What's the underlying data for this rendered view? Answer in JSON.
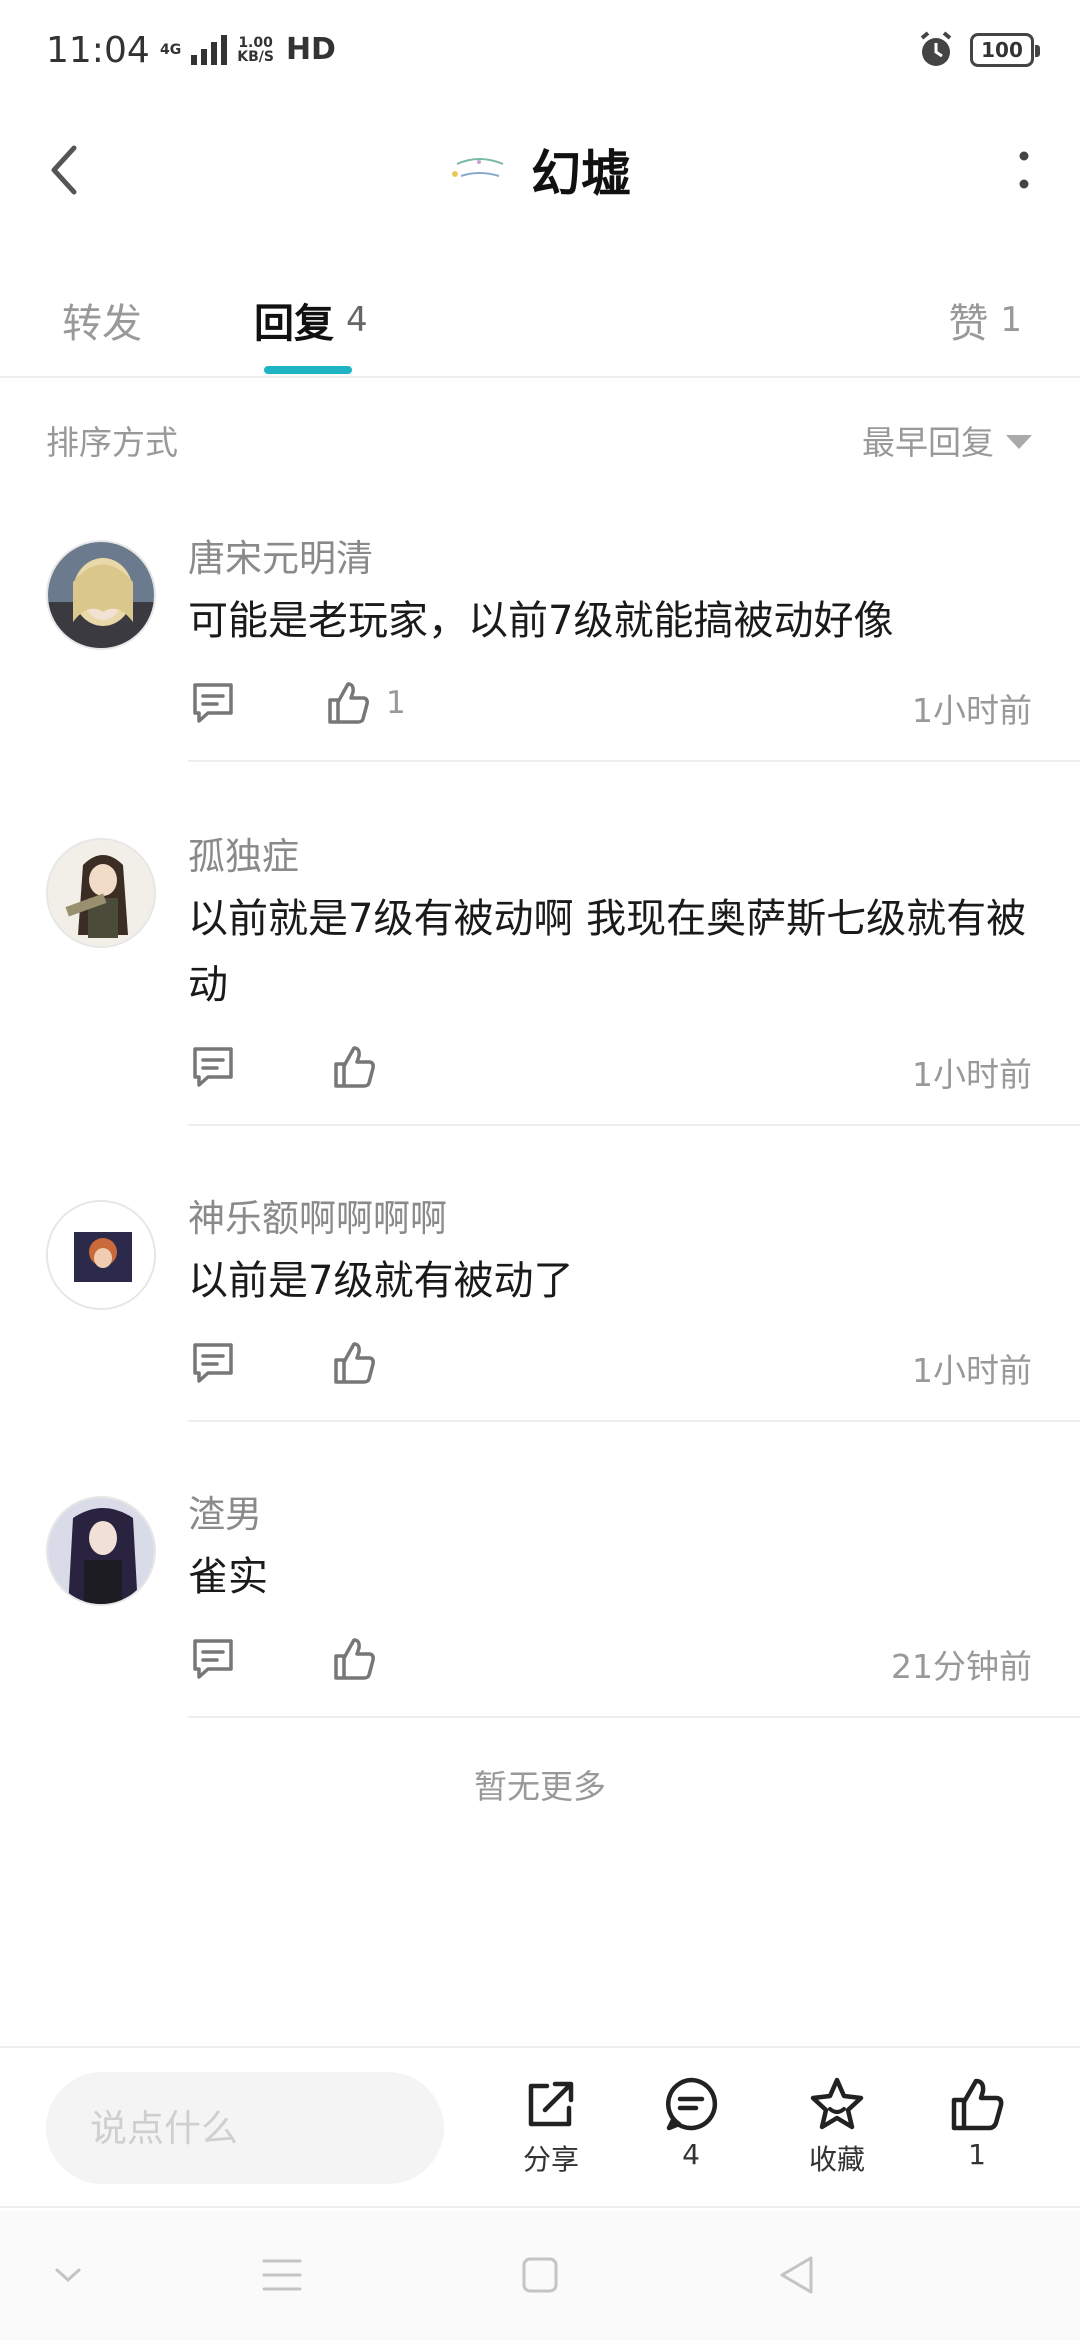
{
  "status_bar": {
    "time": "11:04",
    "network": "4G",
    "speed_value": "1.00",
    "speed_unit": "KB/S",
    "hd": "HD",
    "battery": "100"
  },
  "header": {
    "title": "幻墟"
  },
  "tabs": {
    "forward": {
      "label": "转发"
    },
    "reply": {
      "label": "回复",
      "count": "4"
    },
    "likes": {
      "label": "赞",
      "count": "1"
    },
    "active": "reply",
    "accent_color": "#1fb4c4"
  },
  "sort": {
    "label": "排序方式",
    "selected": "最早回复"
  },
  "comments": [
    {
      "user": "唐宋元明清",
      "text": "可能是老玩家，以前7级就能搞被动好像",
      "likes": "1",
      "time": "1小时前"
    },
    {
      "user": "孤独症",
      "text": "以前就是7级有被动啊    我现在奥萨斯七级就有被动",
      "likes": "",
      "time": "1小时前"
    },
    {
      "user": "神乐额啊啊啊啊",
      "text": "以前是7级就有被动了",
      "likes": "",
      "time": "1小时前"
    },
    {
      "user": "渣男",
      "text": "雀实",
      "likes": "",
      "time": "21分钟前"
    }
  ],
  "footer_note": "暂无更多",
  "action_bar": {
    "input_placeholder": "说点什么",
    "share_label": "分享",
    "comment_count": "4",
    "favorite_label": "收藏",
    "like_count": "1"
  },
  "icons": {
    "back": "chevron-left-icon",
    "more": "more-vertical-icon",
    "comment": "comment-icon",
    "like": "thumbs-up-icon",
    "share": "share-icon",
    "favorite": "star-icon"
  }
}
